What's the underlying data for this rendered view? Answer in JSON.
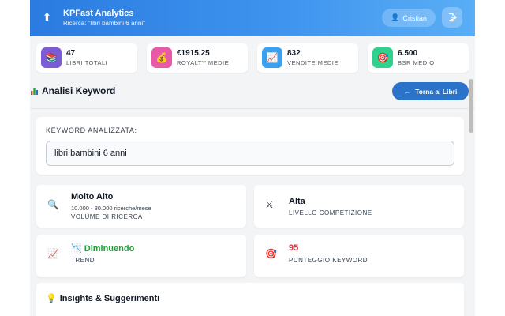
{
  "header": {
    "brand_icon": "⬆",
    "title": "KPFast Analytics",
    "subtitle": "Ricerca: \"libri bambini 6 anni\"",
    "user_name": "Cristian",
    "user_icon": "user-icon",
    "logout_icon": "logout-icon"
  },
  "stats": [
    {
      "icon": "books-icon",
      "glyph": "📚",
      "value": "47",
      "label": "LIBRI TOTALI",
      "color": "#7c5cd6"
    },
    {
      "icon": "money-bag-icon",
      "glyph": "💰",
      "value": "€1915.25",
      "label": "ROYALTY MEDIE",
      "color": "#e85aa8"
    },
    {
      "icon": "chart-up-icon",
      "glyph": "📈",
      "value": "832",
      "label": "VENDITE MEDIE",
      "color": "#3aa0f0"
    },
    {
      "icon": "target-icon",
      "glyph": "🎯",
      "value": "6.500",
      "label": "BSR MEDIO",
      "color": "#2fd28c"
    }
  ],
  "section": {
    "icon": "bar-chart-icon",
    "title": "Analisi Keyword",
    "back_label": "Torna ai Libri",
    "back_icon": "←"
  },
  "keyword": {
    "label": "KEYWORD ANALIZZATA:",
    "value": "libri bambini 6 anni"
  },
  "metrics": [
    {
      "icon": "magnifier-icon",
      "glyph": "🔍",
      "value": "Molto Alto",
      "sub": "10.000 - 30.000 ricerche/mese",
      "label": "VOLUME DI RICERCA",
      "value_color": "#111827"
    },
    {
      "icon": "crossed-swords-icon",
      "glyph": "⚔",
      "value": "Alta",
      "sub": "",
      "label": "LIVELLO COMPETIZIONE",
      "value_color": "#111827"
    },
    {
      "icon": "chart-trend-icon",
      "glyph": "📈",
      "value": "📉 Diminuendo",
      "sub": "",
      "label": "TREND",
      "value_color": "#1f9e3a"
    },
    {
      "icon": "target-icon",
      "glyph": "🎯",
      "value": "95",
      "sub": "",
      "label": "PUNTEGGIO KEYWORD",
      "value_color": "#e0363f"
    }
  ],
  "insights": {
    "icon": "lightbulb-icon",
    "title": "Insights & Suggerimenti"
  }
}
